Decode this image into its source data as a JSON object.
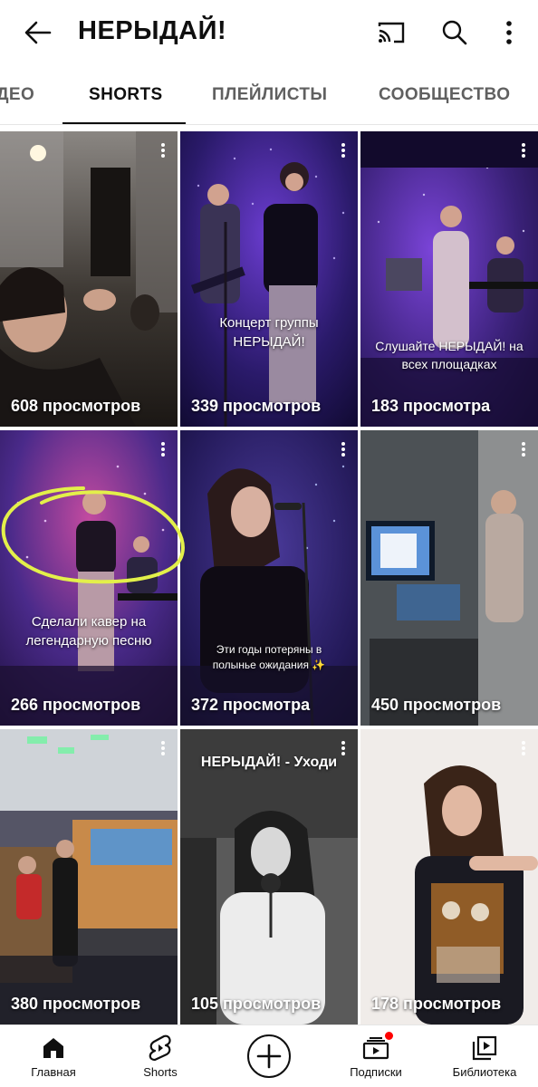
{
  "header": {
    "title": "НЕРЫДАЙ!",
    "back_icon": "arrow-left-icon",
    "cast_icon": "cast-icon",
    "search_icon": "search-icon",
    "more_icon": "more-vertical-icon"
  },
  "tabs": [
    {
      "label": "ДЕО",
      "active": false
    },
    {
      "label": "SHORTS",
      "active": true
    },
    {
      "label": "ПЛЕЙЛИСТЫ",
      "active": false
    },
    {
      "label": "СООБЩЕСТВО",
      "active": false
    }
  ],
  "shorts": [
    {
      "views": "608 просмотров",
      "caption": "",
      "highlighted": true
    },
    {
      "views": "339 просмотров",
      "caption": "Концерт группы НЕРЫДАЙ!"
    },
    {
      "views": "183 просмотра",
      "caption": "Слушайте НЕРЫДАЙ! на всех площадках"
    },
    {
      "views": "266 просмотров",
      "caption": "Сделали кавер на легендарную песню"
    },
    {
      "views": "372 просмотра",
      "caption": "Эти годы потеряны в полынье ожидания ✨"
    },
    {
      "views": "450 просмотров",
      "caption": ""
    },
    {
      "views": "380 просмотров",
      "caption": ""
    },
    {
      "views": "105 просмотров",
      "caption": "НЕРЫДАЙ! - Уходи"
    },
    {
      "views": "178 просмотров",
      "caption": ""
    }
  ],
  "bottom_nav": {
    "home": {
      "label": "Главная",
      "icon": "home-icon"
    },
    "shorts": {
      "label": "Shorts",
      "icon": "shorts-icon"
    },
    "create": {
      "icon": "plus-icon"
    },
    "subscriptions": {
      "label": "Подписки",
      "icon": "subscriptions-icon",
      "has_notification": true
    },
    "library": {
      "label": "Библиотека",
      "icon": "library-icon"
    }
  },
  "colors": {
    "highlight_stroke": "#e3f04a",
    "notification": "#ff0000"
  }
}
